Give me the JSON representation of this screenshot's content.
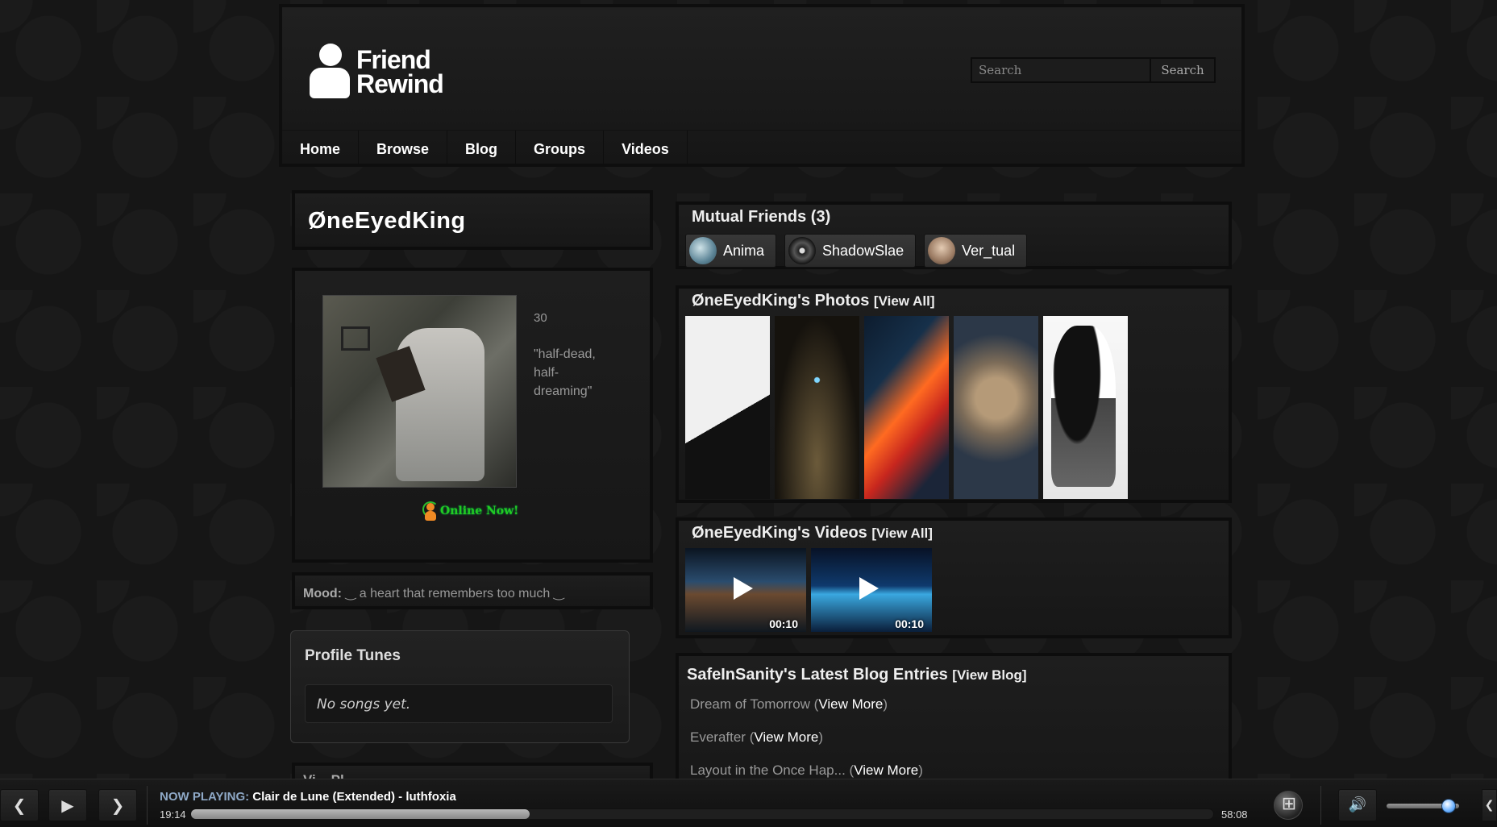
{
  "header": {
    "logo_line1": "Friend",
    "logo_line2": "Rewind",
    "search_placeholder": "Search",
    "search_button": "Search",
    "nav": [
      "Home",
      "Browse",
      "Blog",
      "Groups",
      "Videos"
    ]
  },
  "profile": {
    "display_name": "ØneEyedKing",
    "age": "30",
    "quote": "\"half-dead, half-dreaming\"",
    "online_status": "Online Now!",
    "mood_label": "Mood:",
    "mood_value": "‿ a heart that remembers too much ‿",
    "profile_tunes": {
      "title": "Profile Tunes",
      "empty_text": "No songs yet."
    },
    "next_section_partial": "Vi... Pl..."
  },
  "mutual_friends": {
    "title": "Mutual Friends (3)",
    "friends": [
      {
        "name": "Anima",
        "avatar_color": "#7fa3b0"
      },
      {
        "name": "ShadowSlae",
        "avatar_color": "#555555"
      },
      {
        "name": "Ver_tual",
        "avatar_color": "#b89a82"
      }
    ]
  },
  "photos": {
    "title": "ØneEyedKing's Photos",
    "view_all": "[View All]",
    "count": 5
  },
  "videos": {
    "title": "ØneEyedKing's Videos",
    "view_all": "[View All]",
    "items": [
      {
        "duration": "00:10"
      },
      {
        "duration": "00:10"
      }
    ]
  },
  "blog": {
    "title": "SafeInSanity's Latest Blog Entries",
    "view_blog": "[View Blog]",
    "entries": [
      {
        "title": "Dream of Tomorrow",
        "more": "View More"
      },
      {
        "title": "Everafter",
        "more": "View More"
      },
      {
        "title": "Layout in the Once Hap...",
        "more": "View More"
      }
    ]
  },
  "player": {
    "now_playing_label": "NOW PLAYING:",
    "track": "Clair de Lune (Extended) - luthfoxia",
    "current_time": "19:14",
    "total_time": "58:08",
    "progress_fraction": 0.331,
    "volume_fraction": 0.85,
    "icons": [
      "previous-icon",
      "play-icon",
      "next-icon",
      "windows-logo-icon",
      "volume-icon"
    ]
  }
}
